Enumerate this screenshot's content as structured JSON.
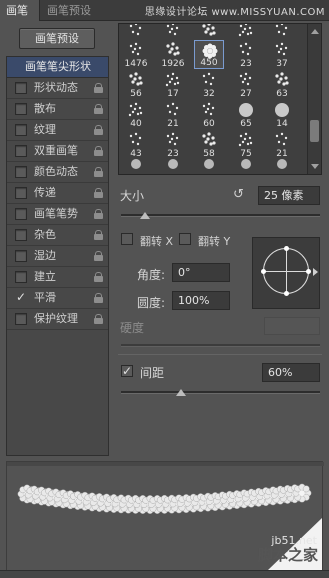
{
  "tabs": [
    {
      "label": "画笔",
      "active": true
    },
    {
      "label": "画笔预设",
      "active": false
    }
  ],
  "top_watermark": "思缘设计论坛 www.MISSYUAN.COM",
  "presets_button": "画笔预设",
  "sidebar": {
    "header": "画笔笔尖形状",
    "items": [
      {
        "label": "形状动态",
        "checked": false,
        "lock": true
      },
      {
        "label": "散布",
        "checked": false,
        "lock": true
      },
      {
        "label": "纹理",
        "checked": false,
        "lock": true
      },
      {
        "label": "双重画笔",
        "checked": false,
        "lock": true
      },
      {
        "label": "颜色动态",
        "checked": false,
        "lock": true
      },
      {
        "label": "传递",
        "checked": false,
        "lock": true
      },
      {
        "label": "画笔笔势",
        "checked": false,
        "lock": true
      },
      {
        "label": "杂色",
        "checked": false,
        "lock": true
      },
      {
        "label": "湿边",
        "checked": false,
        "lock": true
      },
      {
        "label": "建立",
        "checked": false,
        "lock": true
      },
      {
        "label": "平滑",
        "checked": true,
        "lock": true
      },
      {
        "label": "保护纹理",
        "checked": false,
        "lock": true
      }
    ]
  },
  "brush_grid": {
    "rows": [
      [
        "",
        "",
        "",
        "",
        ""
      ],
      [
        "1476",
        "1926",
        "450",
        "23",
        "37"
      ],
      [
        "56",
        "17",
        "32",
        "27",
        "63"
      ],
      [
        "40",
        "21",
        "60",
        "65",
        "14"
      ],
      [
        "43",
        "23",
        "58",
        "75",
        "21"
      ],
      [
        "",
        "",
        "",
        "",
        ""
      ]
    ],
    "selected": "450"
  },
  "size": {
    "label": "大小",
    "value": "25 像素",
    "slider_fraction": 0.12
  },
  "flip_x": {
    "label": "翻转 X",
    "checked": false
  },
  "flip_y": {
    "label": "翻转 Y",
    "checked": false
  },
  "angle": {
    "label": "角度:",
    "value": "0°"
  },
  "roundness": {
    "label": "圆度:",
    "value": "100%"
  },
  "hardness": {
    "label": "硬度",
    "value": "",
    "disabled": true
  },
  "spacing": {
    "label": "间距",
    "checked": true,
    "value": "60%",
    "slider_fraction": 0.3
  },
  "bottom_watermark": {
    "site": "jb51.net",
    "name": "脚本之家"
  }
}
